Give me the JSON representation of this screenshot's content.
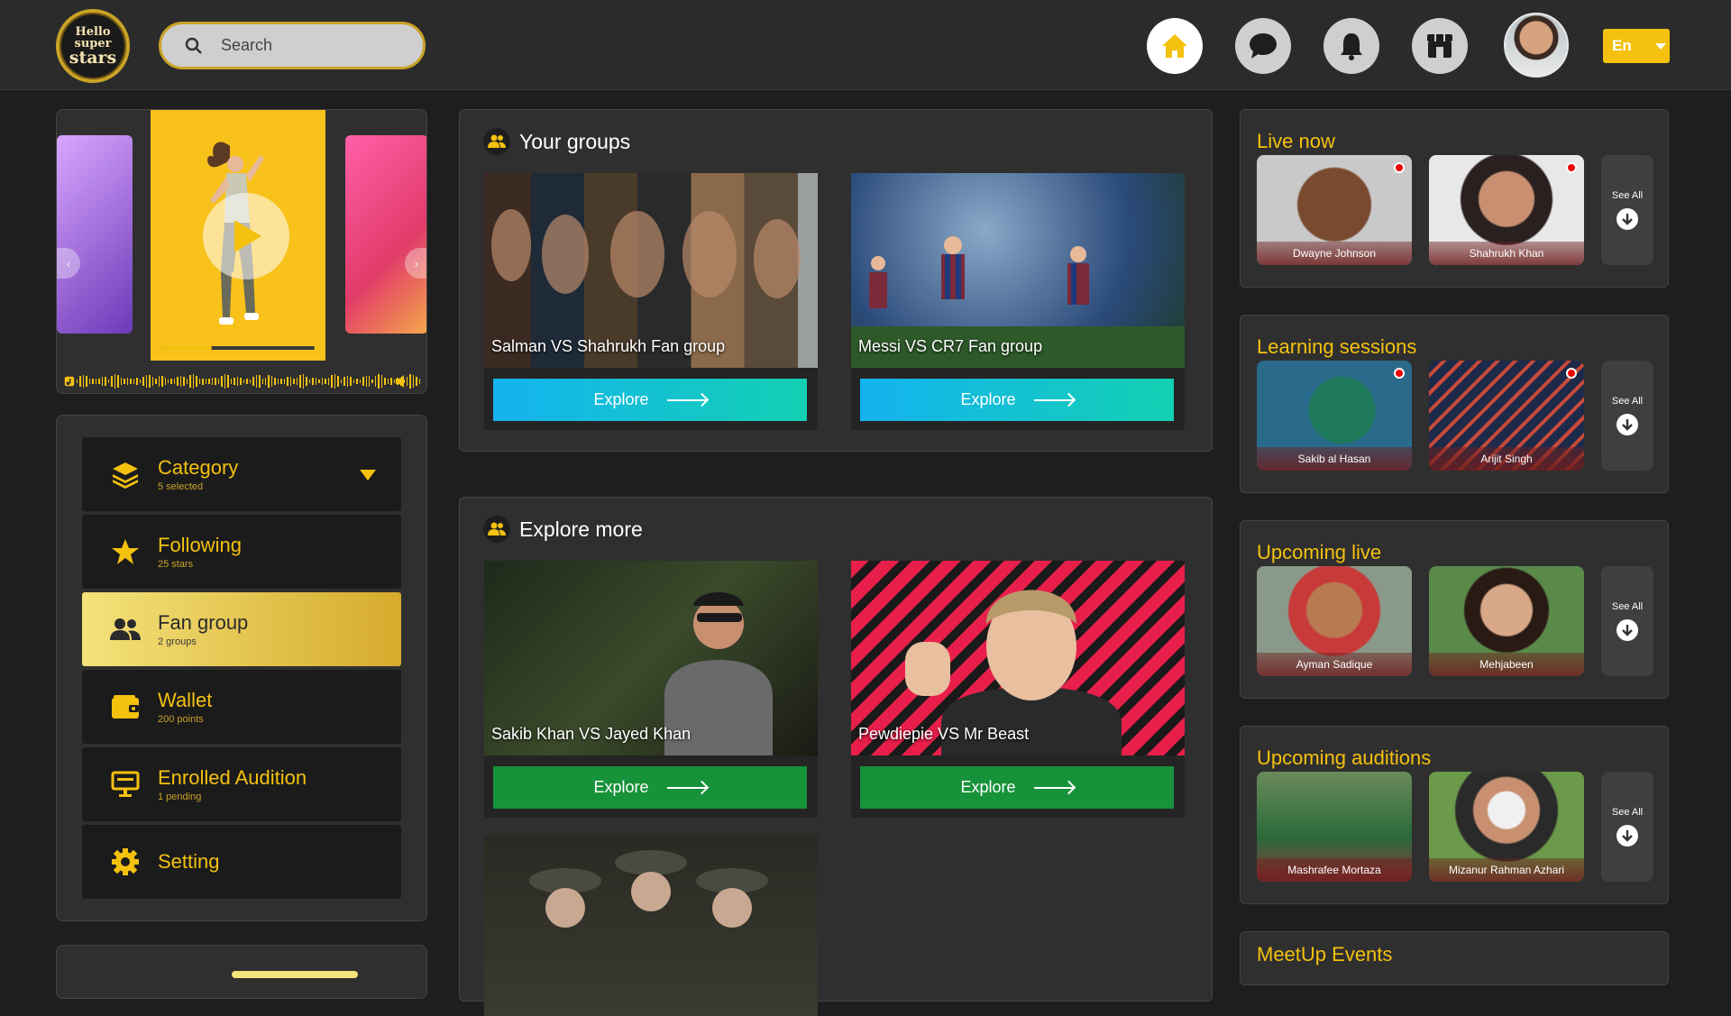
{
  "header": {
    "logo_top": "Hello",
    "logo_mid": "super",
    "logo_bottom": "stars",
    "search_placeholder": "Search",
    "language": "En",
    "nav": [
      "home-icon",
      "chat-icon",
      "bell-icon",
      "store-icon"
    ]
  },
  "player": {
    "progress": 0.33
  },
  "sidebar": {
    "items": [
      {
        "label": "Category",
        "sub": "5 selected"
      },
      {
        "label": "Following",
        "sub": "25 stars"
      },
      {
        "label": "Fan group",
        "sub": "2 groups"
      },
      {
        "label": "Wallet",
        "sub": "200 points"
      },
      {
        "label": "Enrolled Audition",
        "sub": "1 pending"
      },
      {
        "label": "Setting",
        "sub": ""
      }
    ]
  },
  "your_groups": {
    "title": "Your groups",
    "cards": [
      {
        "caption": "Salman VS Shahrukh Fan group",
        "button": "Explore"
      },
      {
        "caption": "Messi VS CR7 Fan group",
        "button": "Explore"
      }
    ]
  },
  "explore_more": {
    "title": "Explore more",
    "cards": [
      {
        "caption": "Sakib Khan VS Jayed Khan",
        "button": "Explore"
      },
      {
        "caption": "Pewdiepie VS Mr Beast",
        "button": "Explore"
      }
    ]
  },
  "right": {
    "see_all": "See All",
    "sections": [
      {
        "title": "Live now",
        "people": [
          "Dwayne Johnson",
          "Shahrukh Khan"
        ]
      },
      {
        "title": "Learning sessions",
        "people": [
          "Sakib al Hasan",
          "Arijit Singh"
        ]
      },
      {
        "title": "Upcoming live",
        "people": [
          "Ayman Sadique",
          "Mehjabeen"
        ]
      },
      {
        "title": "Upcoming auditions",
        "people": [
          "Mashrafee Mortaza",
          "Mizanur Rahman Azhari"
        ]
      },
      {
        "title": "MeetUp Events",
        "people": []
      }
    ]
  },
  "colors": {
    "accent": "#f4c10f",
    "panel": "#2f2f2f",
    "bg": "#1e1e1e"
  }
}
